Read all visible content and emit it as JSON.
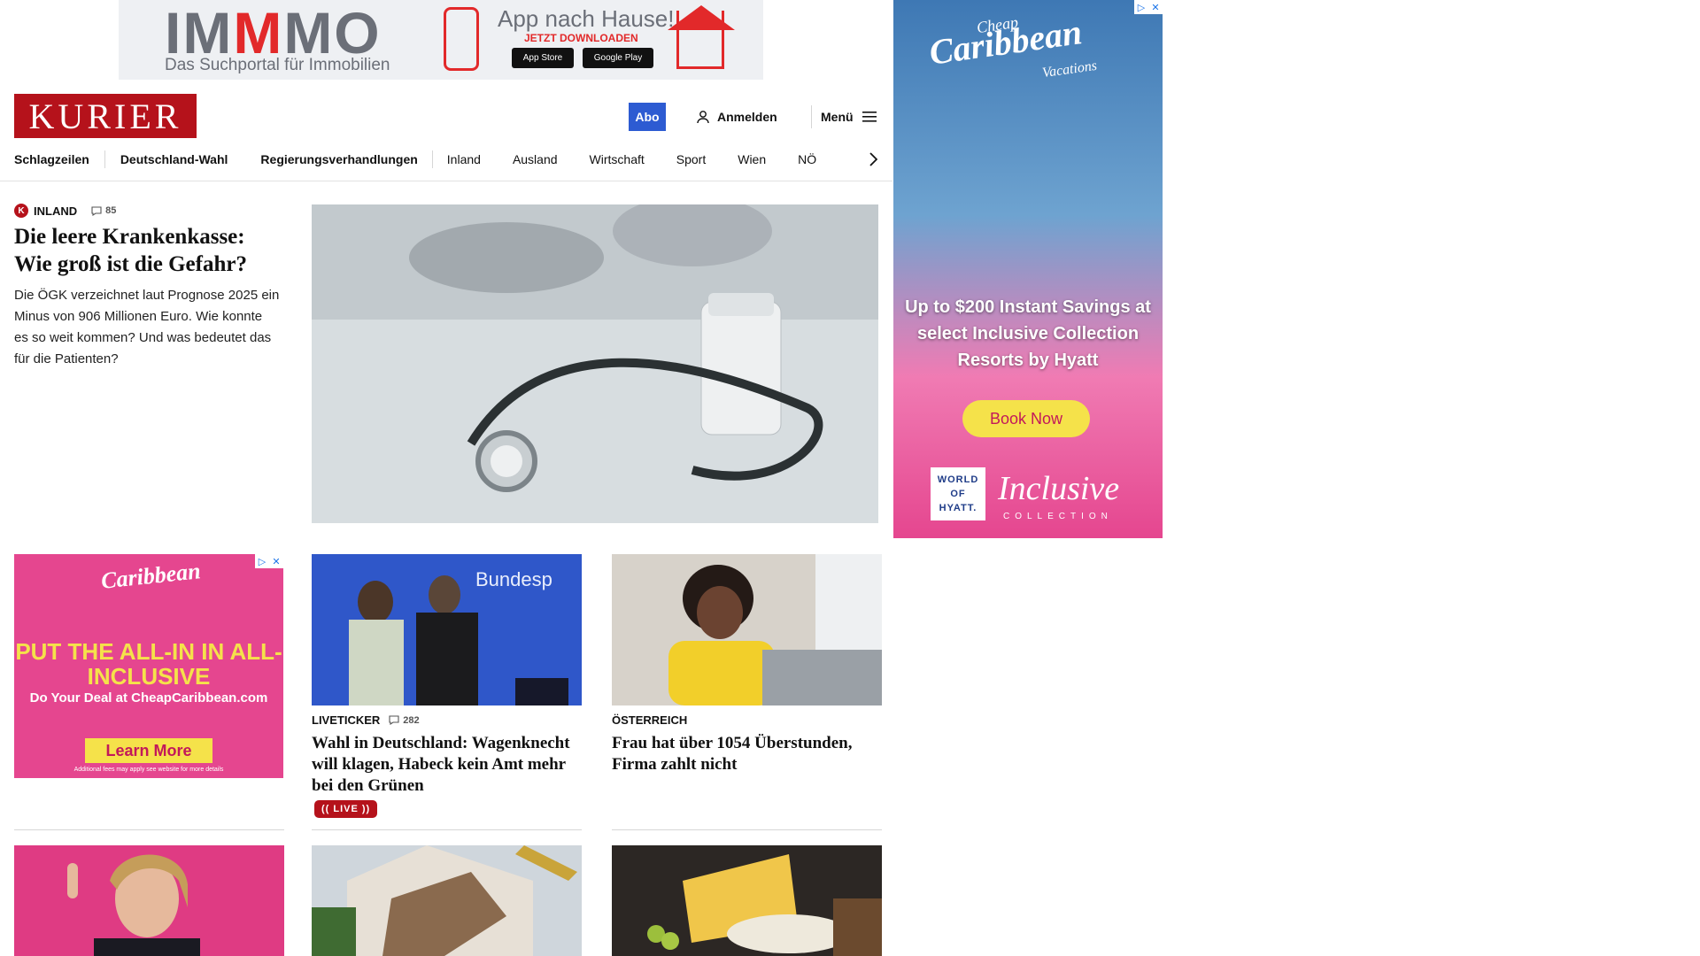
{
  "top_ad": {
    "brand": "IMMMO",
    "brand_parts": [
      "IM",
      "M",
      "MO"
    ],
    "tagline": "Das Suchportal für Immobilien",
    "headline": "App nach Hause!",
    "subline": "JETZT DOWNLOADEN",
    "store1": "App Store",
    "store2": "Google Play"
  },
  "header": {
    "logo": "KURIER",
    "abo": "Abo",
    "login": "Anmelden",
    "menu": "Menü"
  },
  "nav": {
    "items": [
      {
        "label": "Schlagzeilen"
      },
      {
        "label": "Deutschland-Wahl"
      },
      {
        "label": "Regierungsverhandlungen"
      },
      {
        "label": "Inland"
      },
      {
        "label": "Ausland"
      },
      {
        "label": "Wirtschaft"
      },
      {
        "label": "Sport"
      },
      {
        "label": "Wien"
      },
      {
        "label": "NÖ"
      }
    ]
  },
  "lead": {
    "badge": "K",
    "kicker": "INLAND",
    "comments": "85",
    "title": "Die leere Krankenkasse: Wie groß ist die Gefahr?",
    "teaser": "Die ÖGK verzeichnet laut Prognose 2025 ein Minus von 906 Millionen Euro. Wie konnte es so weit kommen? Und was bedeutet das für die Patienten?"
  },
  "side_ad": {
    "cheap": "Cheap",
    "brand": "Caribbean",
    "vacations": "Vacations",
    "offer": "Up to $200 Instant Savings at select Inclusive Collection Resorts by Hyatt",
    "cta": "Book Now",
    "woh": "WORLD OF HYATT.",
    "inclusive": "Inclusive",
    "collection": "COLLECTION"
  },
  "left_ad": {
    "brand": "Caribbean",
    "headline": "PUT THE ALL-IN IN ALL-INCLUSIVE",
    "sub": "Do Your Deal at CheapCaribbean.com",
    "cta": "Learn More",
    "fine": "Additional fees may apply see website for more details"
  },
  "cards": [
    {
      "kicker": "LIVETICKER",
      "comments": "282",
      "title": "Wahl in Deutschland: Wagenknecht will klagen, Habeck kein Amt mehr bei den Grünen",
      "live": "(( LIVE ))",
      "img_text": "Bundesp"
    },
    {
      "kicker": "ÖSTERREICH",
      "title": "Frau hat über 1054 Überstunden, Firma zahlt nicht"
    }
  ],
  "colors": {
    "brand_red": "#b5121b",
    "abo_blue": "#2d5bd2",
    "ad_pink": "#e5468f",
    "ad_yellow": "#f5e24a"
  }
}
